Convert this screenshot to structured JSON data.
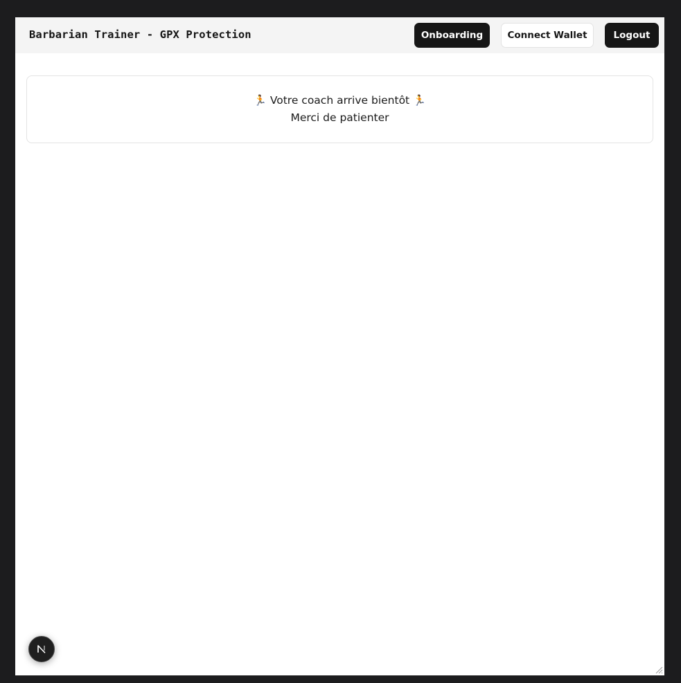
{
  "header": {
    "brand": "Barbarian Trainer - GPX Protection",
    "buttons": {
      "onboarding": "Onboarding",
      "connect_wallet": "Connect Wallet",
      "logout": "Logout"
    }
  },
  "notice": {
    "runner_emoji": "🏃",
    "title": "Votre coach arrive bientôt",
    "subtitle": "Merci de patienter"
  },
  "dev_badge": {
    "letter": "N",
    "icon": "nextjs-icon"
  },
  "colors": {
    "page_background": "#1c1c1e",
    "header_background": "#f4f4f4",
    "button_dark": "#161616",
    "text": "#1a1a1a"
  }
}
